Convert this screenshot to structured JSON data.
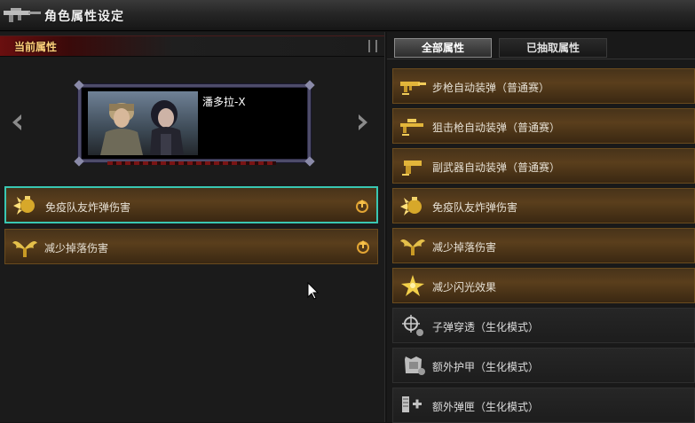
{
  "window": {
    "title": "角色属性设定",
    "icon": "rifle-icon"
  },
  "left_panel": {
    "header": "当前属性",
    "prev_icon": "chevron-left-icon",
    "next_icon": "chevron-right-icon",
    "character": {
      "name": "潘多拉-X"
    },
    "attributes": [
      {
        "label": "免疫队友炸弹伤害",
        "icon": "grenade-icon",
        "action_icon": "upgrade-icon",
        "selected": true
      },
      {
        "label": "减少掉落伤害",
        "icon": "wings-icon",
        "action_icon": "upgrade-icon",
        "selected": false
      }
    ]
  },
  "right_panel": {
    "tabs": [
      {
        "label": "全部属性",
        "active": true
      },
      {
        "label": "已抽取属性",
        "active": false
      }
    ],
    "attributes": [
      {
        "label": "步枪自动装弹（普通赛）",
        "icon": "rifle-reload-icon",
        "style": "gold"
      },
      {
        "label": "狙击枪自动装弹（普通赛）",
        "icon": "sniper-reload-icon",
        "style": "gold"
      },
      {
        "label": "副武器自动装弹（普通赛）",
        "icon": "pistol-reload-icon",
        "style": "gold"
      },
      {
        "label": "免疫队友炸弹伤害",
        "icon": "grenade-icon",
        "style": "gold"
      },
      {
        "label": "减少掉落伤害",
        "icon": "wings-icon",
        "style": "gold"
      },
      {
        "label": "减少闪光效果",
        "icon": "flash-icon",
        "style": "gold"
      },
      {
        "label": "子弹穿透（生化模式）",
        "icon": "crosshair-icon",
        "style": "plain"
      },
      {
        "label": "额外护甲（生化模式）",
        "icon": "armor-icon",
        "style": "plain"
      },
      {
        "label": "额外弹匣（生化模式）",
        "icon": "magazine-icon",
        "style": "plain"
      }
    ]
  },
  "colors": {
    "gold_row": "#5a3e1c",
    "selection": "#39c7b2",
    "header_red": "#6a0f0f",
    "header_text": "#ffd07a"
  }
}
